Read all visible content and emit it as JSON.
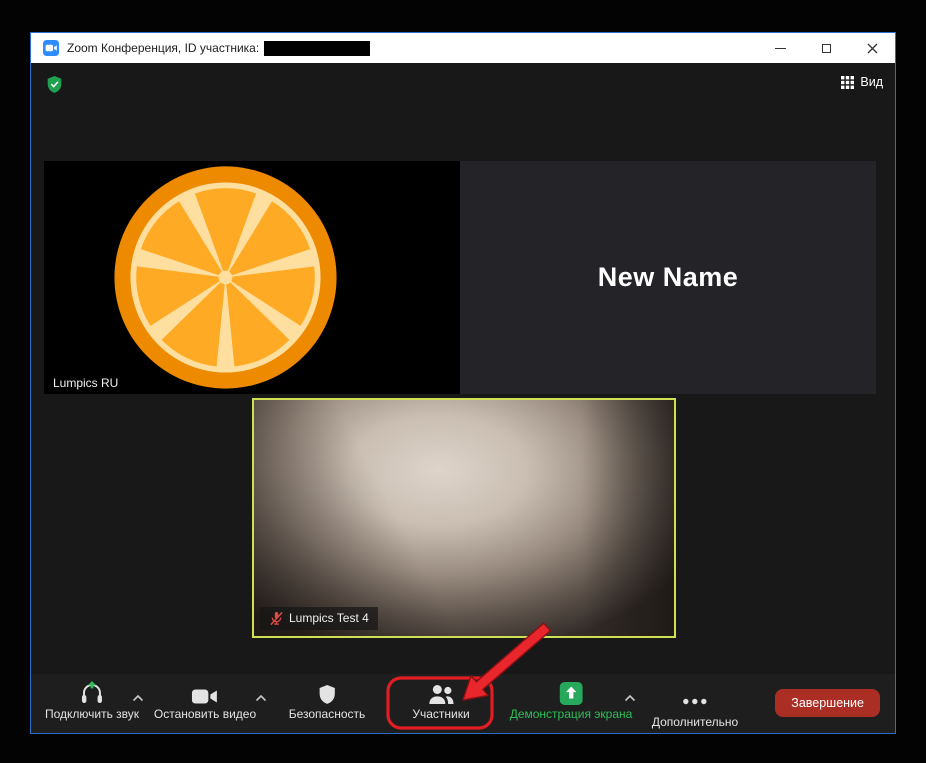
{
  "window": {
    "title": "Zoom Конференция, ID участника:",
    "view_label": "Вид"
  },
  "tiles": {
    "tile1": {
      "label": "Lumpics RU"
    },
    "tile2": {
      "name": "New Name"
    },
    "tile3": {
      "label": "Lumpics Test 4",
      "muted": true
    }
  },
  "toolbar": {
    "join_audio": "Подключить звук",
    "stop_video": "Остановить видео",
    "security": "Безопасность",
    "participants": "Участники",
    "share": "Демонстрация экрана",
    "more": "Дополнительно",
    "end": "Завершение"
  },
  "colors": {
    "zoom_blue": "#2d8cff",
    "share_green": "#2ebd59",
    "encryption_green": "#1fa14f",
    "end_button_red": "#ab2e24",
    "annotation_red": "#e01d23",
    "active_speaker_border": "#cfe052",
    "orange_rind": "#EE8A00",
    "orange_pith": "#FFDFA0",
    "orange_wedge": "#FFAA24"
  }
}
